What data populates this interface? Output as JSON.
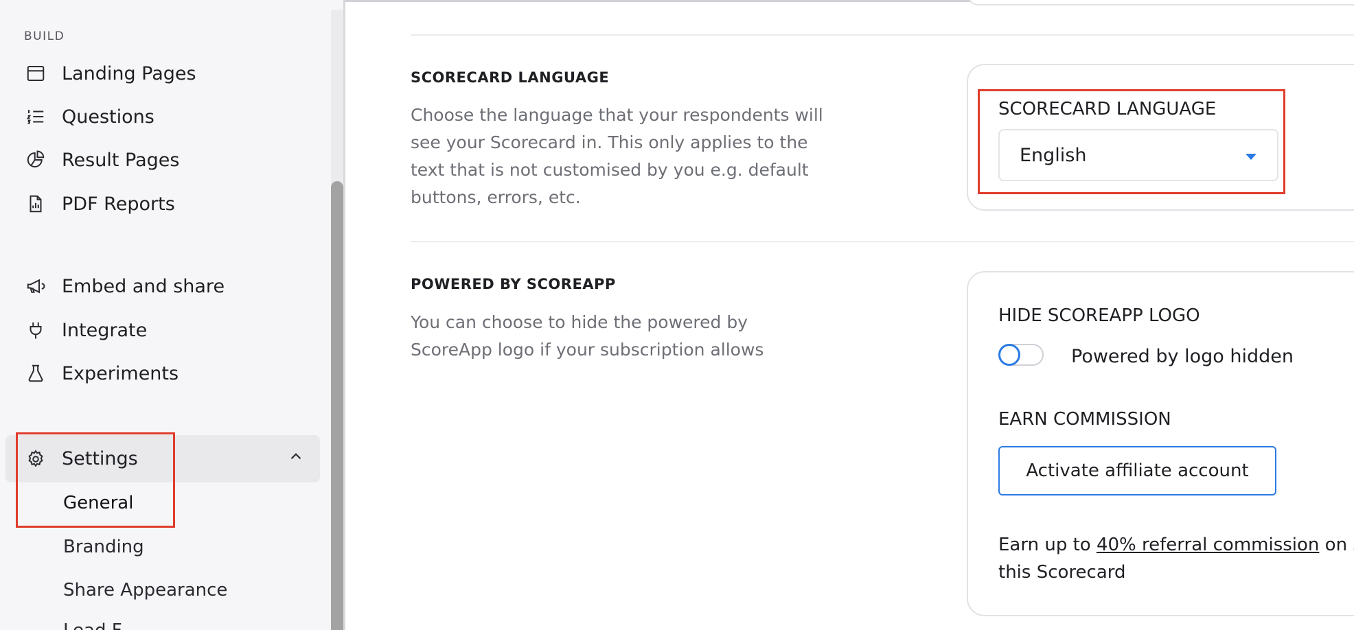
{
  "sidebar": {
    "section_label": "BUILD",
    "items": [
      {
        "label": "Landing Pages",
        "icon": "browser-window-icon"
      },
      {
        "label": "Questions",
        "icon": "numbered-list-icon"
      },
      {
        "label": "Result Pages",
        "icon": "pie-chart-icon"
      },
      {
        "label": "PDF Reports",
        "icon": "document-chart-icon"
      },
      {
        "label": "Embed and share",
        "icon": "megaphone-icon"
      },
      {
        "label": "Integrate",
        "icon": "plug-icon"
      },
      {
        "label": "Experiments",
        "icon": "flask-icon"
      }
    ],
    "settings": {
      "label": "Settings",
      "icon": "gear-icon",
      "expanded": true,
      "subitems": [
        "General",
        "Branding",
        "Share Appearance",
        "Lead F"
      ]
    }
  },
  "main": {
    "language_section": {
      "title": "SCORECARD LANGUAGE",
      "description": "Choose the language that your respondents will see your Scorecard in. This only applies to the text that is not customised by you e.g. default buttons, errors, etc.",
      "field_label": "SCORECARD LANGUAGE",
      "selected_value": "English"
    },
    "powered_section": {
      "title": "POWERED BY SCOREAPP",
      "description": "You can choose to hide the powered by ScoreApp logo if your subscription allows",
      "hide_logo_label": "HIDE SCOREAPP LOGO",
      "toggle_label": "Powered by logo hidden",
      "toggle_on": false,
      "commission_label": "EARN COMMISSION",
      "activate_button": "Activate affiliate account",
      "commission_text_before": "Earn up to ",
      "commission_link": "40% referral commission",
      "commission_text_after": " on s",
      "commission_text_line2": "this Scorecard"
    }
  },
  "colors": {
    "accent": "#2b7be4",
    "highlight": "#e03c2c",
    "sidebar_bg": "#f6f6f8",
    "active_item_bg": "#e9e9ec"
  }
}
